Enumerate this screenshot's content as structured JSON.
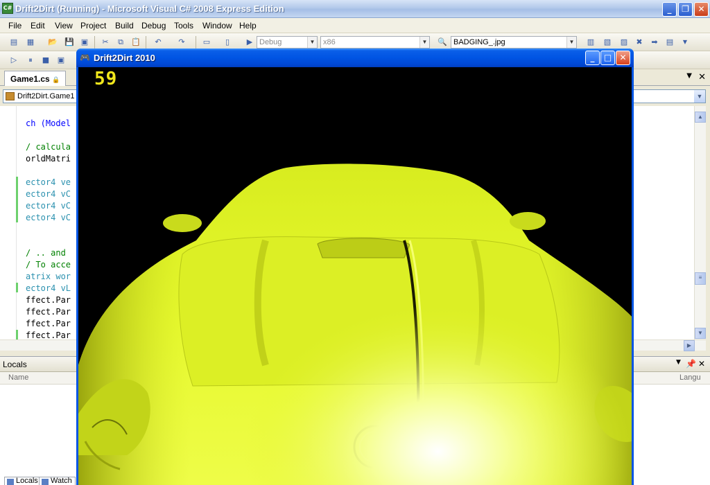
{
  "vs": {
    "title": "Drift2Dirt (Running) - Microsoft Visual C# 2008 Express Edition",
    "icon": "C#"
  },
  "menu": [
    "File",
    "Edit",
    "View",
    "Project",
    "Build",
    "Debug",
    "Tools",
    "Window",
    "Help"
  ],
  "toolbar": {
    "config_combo": "Debug",
    "platform_combo": "x86",
    "find_combo": "BADGING_.jpg"
  },
  "doc_tab": {
    "label": "Game1.cs"
  },
  "nav": {
    "class_combo": "Drift2Dirt.Game1"
  },
  "code_lines": [
    "ch (Model",
    "",
    "/ calcula",
    "orldMatri",
    "",
    "ector4 ve",
    "ector4 vC",
    "ector4 vC",
    "ector4 vC",
    "",
    "",
    "/ .. and",
    "/ To acce",
    "atrix wor",
    "ector4 vL",
    "ffect.Par",
    "ffect.Par",
    "ffect.Par",
    "ffect.Par"
  ],
  "locals": {
    "title": "Locals",
    "col_name": "Name",
    "col_lang": "Langu",
    "tabs": [
      "Locals",
      "Watch"
    ]
  },
  "game": {
    "title": "Drift2Dirt 2010",
    "fps": "59"
  },
  "colors": {
    "car_body": "#e3f52a",
    "fps_text": "#f0e61c",
    "xp_titlebar": "#0054e3"
  }
}
